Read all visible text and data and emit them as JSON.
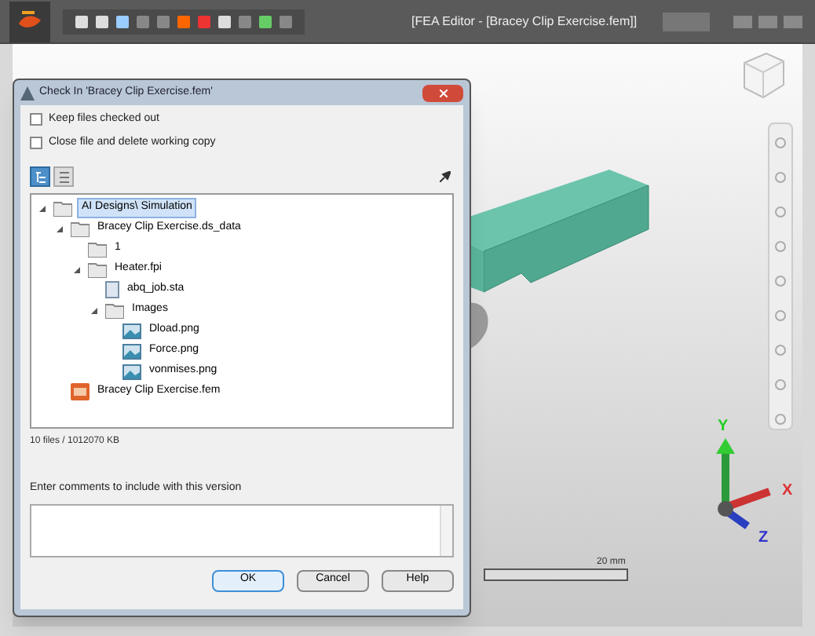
{
  "window": {
    "title": "[FEA Editor - [Bracey Clip Exercise.fem]]"
  },
  "dialog": {
    "title": "Check In 'Bracey Clip Exercise.fem'",
    "options": [
      {
        "label": "Keep files checked out",
        "checked": false
      },
      {
        "label": "Close file and delete working copy",
        "checked": false
      }
    ],
    "view_buttons": [
      {
        "kind": "tree",
        "selected": true
      },
      {
        "kind": "list",
        "selected": false
      }
    ],
    "tree": [
      {
        "label": "AI Designs\\ Simulation",
        "kind": "folder",
        "selected": true,
        "expanded": true,
        "children": [
          {
            "label": "Bracey Clip Exercise.ds_data",
            "kind": "folder",
            "selected": false,
            "expanded": true,
            "children": [
              {
                "label": "1",
                "kind": "folder",
                "selected": false
              },
              {
                "label": "Heater.fpi",
                "kind": "folder",
                "selected": false,
                "expanded": true,
                "children": [
                  {
                    "label": "abq_job.sta",
                    "kind": "file",
                    "selected": false
                  },
                  {
                    "label": "Images",
                    "kind": "folder",
                    "selected": false,
                    "expanded": true,
                    "children": [
                      {
                        "label": "Dload.png",
                        "kind": "image",
                        "selected": false
                      },
                      {
                        "label": "Force.png",
                        "kind": "image",
                        "selected": false
                      },
                      {
                        "label": "vonmises.png",
                        "kind": "image",
                        "selected": false
                      }
                    ]
                  }
                ]
              }
            ]
          },
          {
            "label": "Bracey Clip Exercise.fem",
            "kind": "model",
            "selected": false
          }
        ]
      }
    ],
    "summary": "10 files / 1012070 KB",
    "comment_label": "Enter comments to include with this version",
    "buttons": [
      {
        "label": "OK",
        "selected": true
      },
      {
        "label": "Cancel",
        "selected": false
      },
      {
        "label": "Help",
        "selected": false
      }
    ]
  },
  "viewport": {
    "axes": [
      "Y",
      "X",
      "Z"
    ],
    "scale": "20 mm"
  }
}
